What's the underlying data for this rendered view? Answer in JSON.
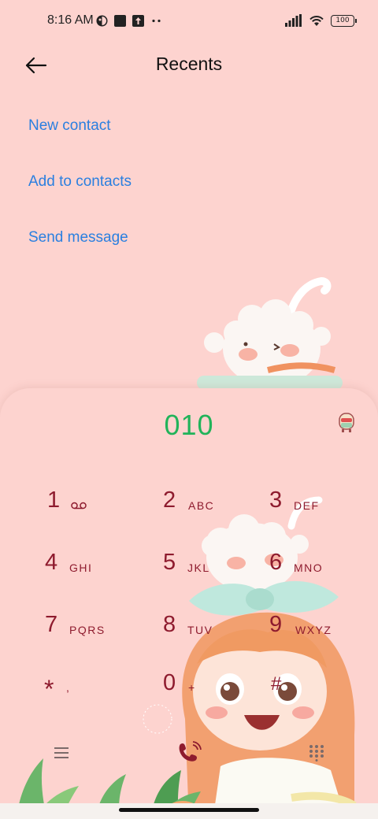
{
  "status_bar": {
    "time": "8:16 AM",
    "battery": "100",
    "icons": [
      "app-notification-icon",
      "square-icon",
      "upload-icon",
      "more-dots-icon",
      "signal-icon",
      "wifi-icon",
      "battery-icon"
    ]
  },
  "header": {
    "title": "Recents",
    "back_icon": "arrow-left-icon"
  },
  "actions": {
    "new_contact": "New contact",
    "add_to_contacts": "Add to contacts",
    "send_message": "Send message"
  },
  "dialer": {
    "number": "010",
    "keys": [
      {
        "digit": "1",
        "letters": ""
      },
      {
        "digit": "2",
        "letters": "ABC"
      },
      {
        "digit": "3",
        "letters": "DEF"
      },
      {
        "digit": "4",
        "letters": "GHI"
      },
      {
        "digit": "5",
        "letters": "JKL"
      },
      {
        "digit": "6",
        "letters": "MNO"
      },
      {
        "digit": "7",
        "letters": "PQRS"
      },
      {
        "digit": "8",
        "letters": "TUV"
      },
      {
        "digit": "9",
        "letters": "WXYZ"
      },
      {
        "digit": "*",
        "letters": ","
      },
      {
        "digit": "0",
        "letters": "+"
      },
      {
        "digit": "#",
        "letters": ""
      }
    ],
    "bottom_icons": [
      "menu-icon",
      "call-icon",
      "keypad-icon"
    ]
  },
  "colors": {
    "background": "#fdd3cf",
    "link": "#2a7fe0",
    "number": "#21b35a",
    "key": "#8e1b2e"
  }
}
